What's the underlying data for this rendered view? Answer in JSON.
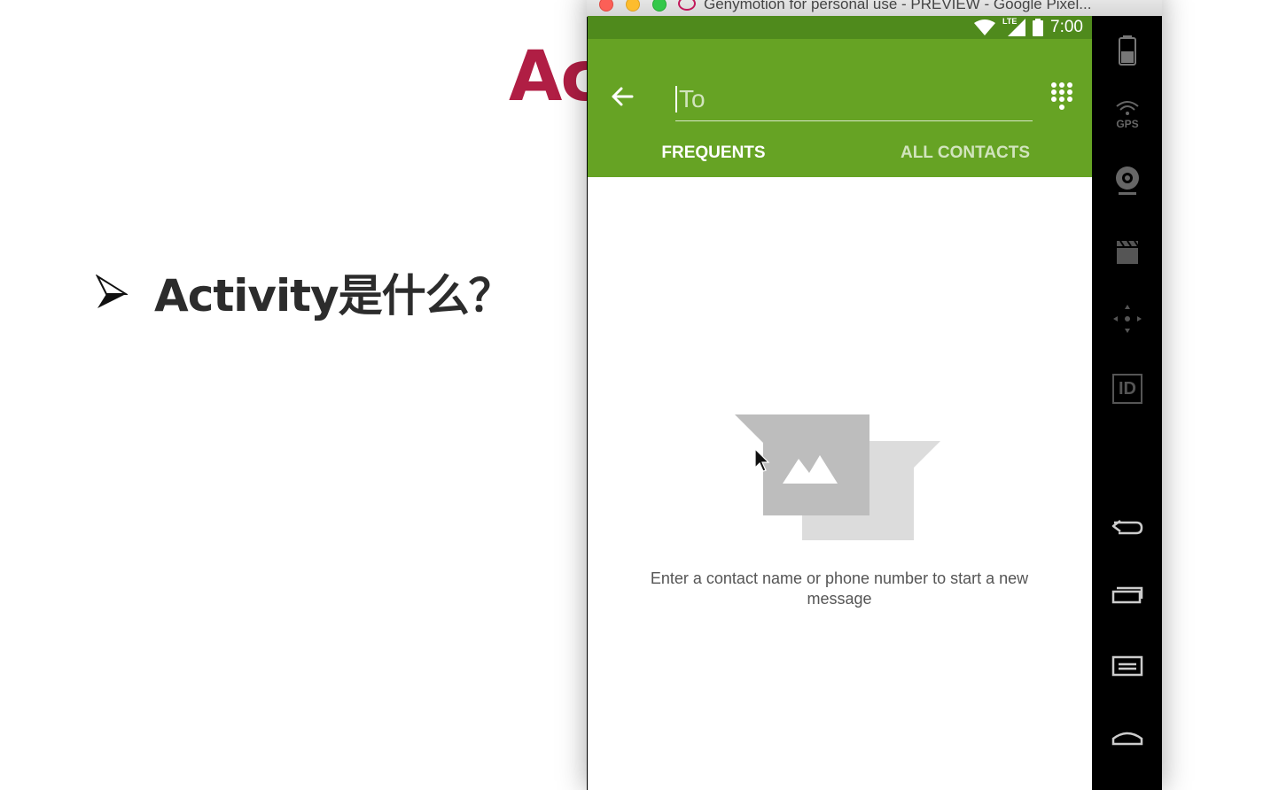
{
  "slide": {
    "title": "Ac",
    "bullet": "Activity是什么？"
  },
  "window": {
    "title": "Genymotion for personal use - PREVIEW - Google Pixel..."
  },
  "status_bar": {
    "network": "LTE",
    "time": "7:00"
  },
  "compose": {
    "to_placeholder": "To",
    "tabs": [
      {
        "label": "FREQUENTS",
        "selected": true
      },
      {
        "label": "ALL CONTACTS",
        "selected": false
      }
    ],
    "empty_message": "Enter a contact name or phone number to start a new message"
  },
  "side_toolbar": {
    "gps_label": "GPS",
    "id_label": "ID"
  },
  "colors": {
    "app_bar": "#66a324",
    "status_bar": "#4f8a1c",
    "slide_title": "#b01e44"
  }
}
